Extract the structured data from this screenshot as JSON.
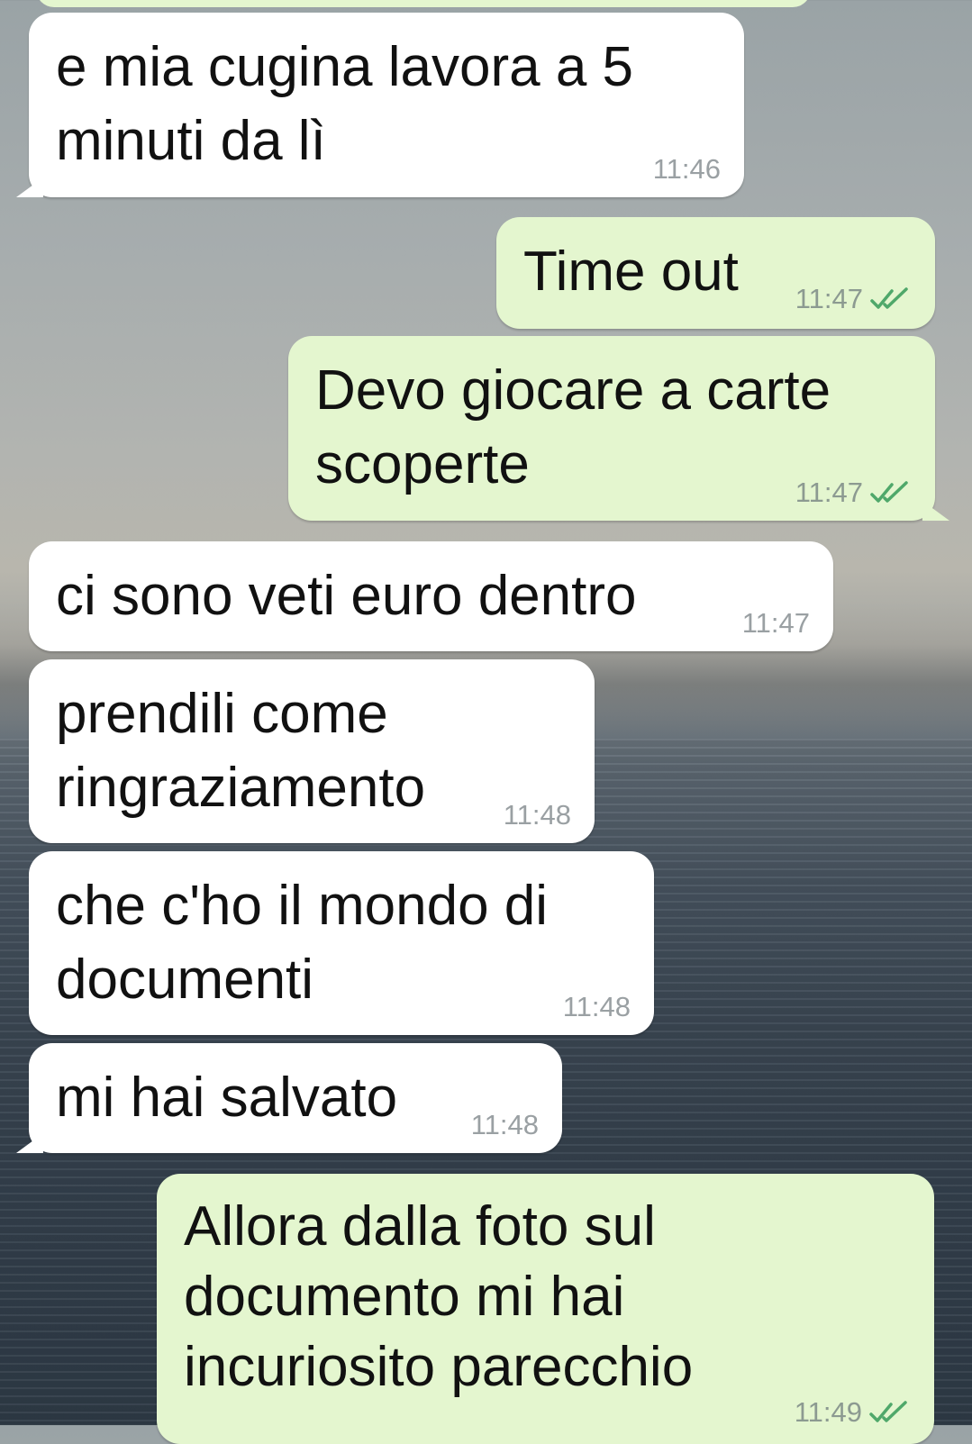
{
  "chat": {
    "messages": [
      {
        "direction": "in",
        "text": "e mia cugina lavora a 5\nminuti da lì",
        "time": "11:46"
      },
      {
        "direction": "out",
        "text": "Time out",
        "time": "11:47",
        "status": "read"
      },
      {
        "direction": "out",
        "text": "Devo giocare a carte\nscoperte",
        "time": "11:47",
        "status": "read"
      },
      {
        "direction": "in",
        "text": "ci sono veti euro dentro",
        "time": "11:47"
      },
      {
        "direction": "in",
        "text": "prendili come\nringraziamento",
        "time": "11:48"
      },
      {
        "direction": "in",
        "text": "che c'ho il mondo di\ndocumenti",
        "time": "11:48"
      },
      {
        "direction": "in",
        "text": "mi hai salvato",
        "time": "11:48"
      },
      {
        "direction": "out",
        "text": "Allora dalla foto sul\ndocumento mi hai\nincuriosito parecchio",
        "time": "11:49",
        "status": "read"
      }
    ]
  },
  "colors": {
    "incoming_bubble": "#ffffff",
    "outgoing_bubble": "#e4f6cf",
    "read_ticks": "#4fa86a",
    "timestamp": "#8c9a91"
  }
}
